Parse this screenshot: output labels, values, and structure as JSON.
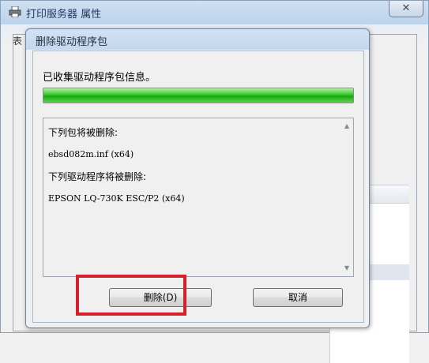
{
  "parent_window": {
    "title": "打印服务器 属性",
    "close_label": "✕",
    "tab_fragment": "表"
  },
  "dialog": {
    "title": "删除驱动程序包",
    "status": "已收集驱动程序包信息。",
    "progress": 1.0,
    "details": {
      "packages_heading": "下列包将被删除:",
      "package_name": "ebsd082m.inf (x64)",
      "drivers_heading": "下列驱动程序将被删除:",
      "driver_name": "EPSON LQ-730K ESC/P2 (x64)"
    },
    "buttons": {
      "delete": "删除(D)",
      "cancel": "取消"
    }
  },
  "colors": {
    "progress_green": "#16a80f",
    "highlight_red": "#d4202a"
  }
}
